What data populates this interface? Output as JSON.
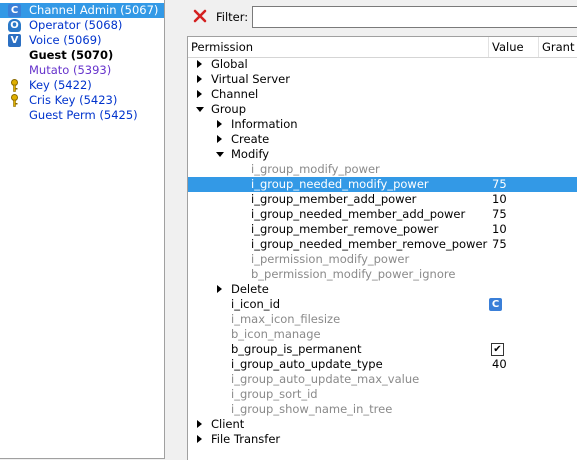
{
  "groups": [
    {
      "label": "Channel Admin (5067)",
      "icon": "channel-admin-icon"
    },
    {
      "label": "Operator (5068)",
      "icon": "operator-icon"
    },
    {
      "label": "Voice (5069)",
      "icon": "voice-icon"
    },
    {
      "label": "Guest (5070)",
      "icon": ""
    },
    {
      "label": "Mutato (5393)",
      "icon": ""
    },
    {
      "label": "Key (5422)",
      "icon": "key-icon"
    },
    {
      "label": "Cris Key (5423)",
      "icon": "key-icon"
    },
    {
      "label": "Guest Perm (5425)",
      "icon": ""
    }
  ],
  "icons": {
    "channel_admin": "C",
    "operator": "O",
    "voice": "V"
  },
  "toolbar": {
    "filter_label": "Filter:",
    "filter_value": ""
  },
  "columns": {
    "permission": "Permission",
    "value": "Value",
    "grant": "Grant"
  },
  "tree": [
    {
      "label": "Global",
      "value": ""
    },
    {
      "label": "Virtual Server",
      "value": ""
    },
    {
      "label": "Channel",
      "value": ""
    },
    {
      "label": "Group",
      "value": ""
    },
    {
      "label": "Information",
      "value": ""
    },
    {
      "label": "Create",
      "value": ""
    },
    {
      "label": "Modify",
      "value": ""
    },
    {
      "label": "i_group_modify_power",
      "value": ""
    },
    {
      "label": "i_group_needed_modify_power",
      "value": "75"
    },
    {
      "label": "i_group_member_add_power",
      "value": "10"
    },
    {
      "label": "i_group_needed_member_add_power",
      "value": "75"
    },
    {
      "label": "i_group_member_remove_power",
      "value": "10"
    },
    {
      "label": "i_group_needed_member_remove_power",
      "value": "75"
    },
    {
      "label": "i_permission_modify_power",
      "value": ""
    },
    {
      "label": "b_permission_modify_power_ignore",
      "value": ""
    },
    {
      "label": "Delete",
      "value": ""
    },
    {
      "label": "i_icon_id",
      "value": ""
    },
    {
      "label": "i_max_icon_filesize",
      "value": ""
    },
    {
      "label": "b_icon_manage",
      "value": ""
    },
    {
      "label": "b_group_is_permanent",
      "value": ""
    },
    {
      "label": "i_group_auto_update_type",
      "value": "40"
    },
    {
      "label": "i_group_auto_update_max_value",
      "value": ""
    },
    {
      "label": "i_group_sort_id",
      "value": ""
    },
    {
      "label": "i_group_show_name_in_tree",
      "value": ""
    },
    {
      "label": "Client",
      "value": ""
    },
    {
      "label": "File Transfer",
      "value": ""
    }
  ],
  "checkmark": "✔"
}
